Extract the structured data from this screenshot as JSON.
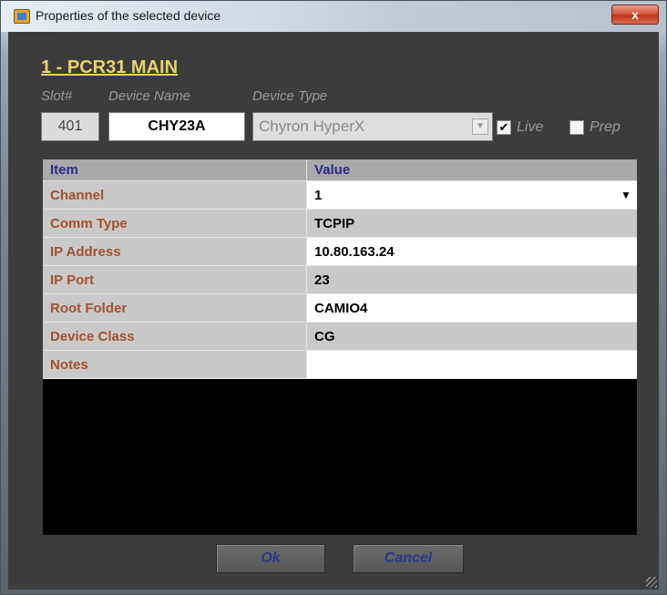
{
  "window": {
    "title": "Properties of the selected device",
    "close_label": "x"
  },
  "device": {
    "heading": "1 - PCR31  MAIN",
    "labels": {
      "slot": "Slot#",
      "name": "Device Name",
      "type": "Device Type"
    },
    "slot": "401",
    "name": "CHY23A",
    "type": "Chyron HyperX",
    "live_label": "Live",
    "live_checked": true,
    "prep_label": "Prep",
    "prep_checked": false
  },
  "grid": {
    "headers": [
      "Item",
      "Value"
    ],
    "rows": [
      {
        "item": "Channel",
        "value": "1",
        "editable": true,
        "has_dropdown": true
      },
      {
        "item": "Comm Type",
        "value": "TCPIP",
        "editable": false
      },
      {
        "item": "IP Address",
        "value": "10.80.163.24",
        "editable": true
      },
      {
        "item": "IP Port",
        "value": "23",
        "editable": false
      },
      {
        "item": "Root Folder",
        "value": "CAMIO4",
        "editable": true
      },
      {
        "item": "Device Class",
        "value": "CG",
        "editable": false
      },
      {
        "item": "Notes",
        "value": "",
        "editable": true
      }
    ]
  },
  "buttons": {
    "ok": "Ok",
    "cancel": "Cancel"
  },
  "colors": {
    "heading": "#e8d36a",
    "item_text": "#a0522d",
    "header_text": "#2a2a8a",
    "button_text": "#2a3a8a"
  }
}
